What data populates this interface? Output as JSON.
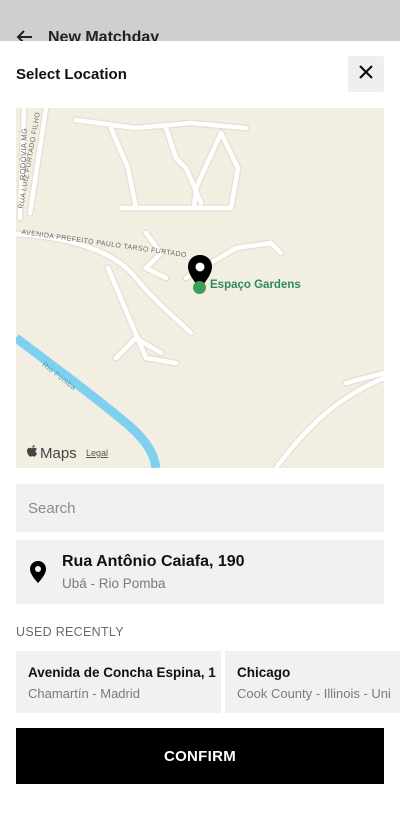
{
  "background_page": {
    "title": "New Matchday",
    "back_icon": "arrow-left-icon"
  },
  "sheet": {
    "title": "Select Location",
    "close_icon": "close-icon"
  },
  "map": {
    "place_label": "Espaço Gardens",
    "maps_brand": "Maps",
    "legal_link": "Legal",
    "street_labels": {
      "rodovia": "RODOVIA MG",
      "luiz": "RUA LUIZ FURTADO FILHO",
      "avenida": "AVENIDA PREFEITO PAULO TARSO FURTADO",
      "rio": "Rio Pomba"
    },
    "colors": {
      "land": "#f2eee2",
      "river": "#7fd0ee",
      "road": "#ffffff",
      "pin": "#000000",
      "place": "#2e8b57"
    }
  },
  "search": {
    "placeholder": "Search",
    "value": ""
  },
  "selected_location": {
    "street": "Rua Antônio Caiafa, 190",
    "area": "Ubá - Rio Pomba",
    "icon": "location-pin-icon"
  },
  "recent": {
    "label": "USED RECENTLY",
    "items": [
      {
        "title": "Avenida de Concha Espina, 1",
        "subtitle": "Chamartín - Madrid"
      },
      {
        "title": "Chicago",
        "subtitle": "Cook County - Illinois - Uni"
      }
    ]
  },
  "confirm_label": "CONFIRM"
}
